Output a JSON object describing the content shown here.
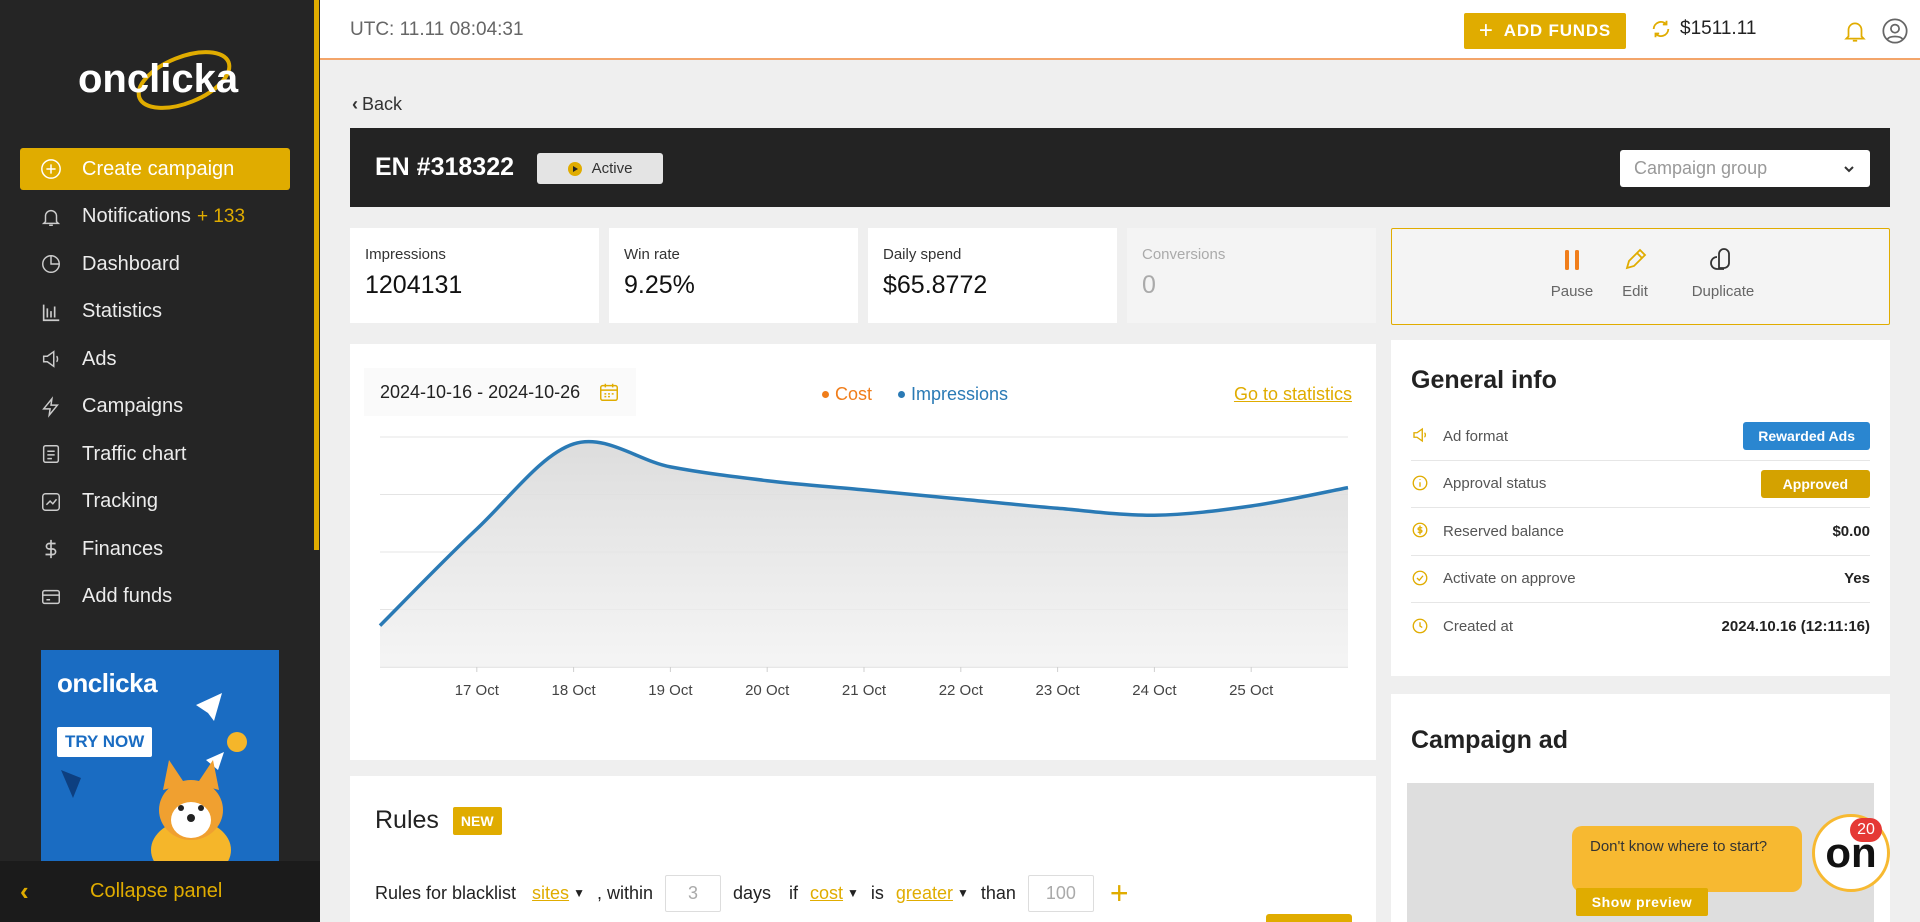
{
  "sidebar": {
    "logo_text": "onclicka",
    "items": [
      {
        "label": "Create campaign",
        "icon": "plus-circle-icon"
      },
      {
        "label": "Notifications",
        "badge": "+ 133",
        "icon": "bell-icon"
      },
      {
        "label": "Dashboard",
        "icon": "pie-chart-icon"
      },
      {
        "label": "Statistics",
        "icon": "bar-chart-icon"
      },
      {
        "label": "Ads",
        "icon": "megaphone-icon"
      },
      {
        "label": "Campaigns",
        "icon": "lightning-icon"
      },
      {
        "label": "Traffic chart",
        "icon": "document-icon"
      },
      {
        "label": "Tracking",
        "icon": "trend-icon"
      },
      {
        "label": "Finances",
        "icon": "dollar-icon"
      },
      {
        "label": "Add funds",
        "icon": "card-icon"
      }
    ],
    "promo": {
      "logo": "onclicka",
      "button": "TRY NOW"
    },
    "collapse_label": "Collapse panel"
  },
  "topbar": {
    "utc": "UTC: 11.11 08:04:31",
    "add_funds": "ADD FUNDS",
    "balance": "$1511.11"
  },
  "back_label": "Back",
  "campaign": {
    "title": "EN #318322",
    "status": "Active",
    "group_placeholder": "Campaign group"
  },
  "stats": [
    {
      "label": "Impressions",
      "value": "1204131"
    },
    {
      "label": "Win rate",
      "value": "9.25%"
    },
    {
      "label": "Daily spend",
      "value": "$65.8772"
    },
    {
      "label": "Conversions",
      "value": "0"
    }
  ],
  "actions": {
    "pause": "Pause",
    "edit": "Edit",
    "duplicate": "Duplicate"
  },
  "chart": {
    "date_range": "2024-10-16 - 2024-10-26",
    "legend_cost": "Cost",
    "legend_impressions": "Impressions",
    "goto": "Go to statistics"
  },
  "chart_data": {
    "type": "area",
    "categories": [
      "17 Oct",
      "18 Oct",
      "19 Oct",
      "20 Oct",
      "21 Oct",
      "22 Oct",
      "23 Oct",
      "24 Oct",
      "25 Oct"
    ],
    "series": [
      {
        "name": "Impressions",
        "color": "#2a7ab5",
        "x": [
          "16 Oct",
          "17 Oct",
          "18 Oct",
          "19 Oct",
          "20 Oct",
          "21 Oct",
          "22 Oct",
          "23 Oct",
          "24 Oct",
          "25 Oct",
          "26 Oct"
        ],
        "values": [
          0.18,
          0.6,
          0.97,
          0.87,
          0.81,
          0.77,
          0.73,
          0.69,
          0.66,
          0.7,
          0.78
        ]
      },
      {
        "name": "Cost",
        "color": "#f07d1a",
        "values": []
      }
    ],
    "grid": true,
    "legend": "top-center"
  },
  "general_info": {
    "title": "General info",
    "rows": [
      {
        "label": "Ad format",
        "value": "Rewarded Ads",
        "type": "badge",
        "color": "#2a86d0"
      },
      {
        "label": "Approval status",
        "value": "Approved",
        "type": "badge",
        "color": "#d4a200"
      },
      {
        "label": "Reserved balance",
        "value": "$0.00",
        "type": "text"
      },
      {
        "label": "Activate on approve",
        "value": "Yes",
        "type": "text"
      },
      {
        "label": "Created at",
        "value": "2024.10.16 (12:11:16)",
        "type": "text"
      }
    ]
  },
  "campaign_ad": {
    "title": "Campaign ad"
  },
  "rules": {
    "title": "Rules",
    "badge": "NEW",
    "prefix": "Rules for blacklist",
    "target": "sites",
    "within": ", within",
    "days_value": "3",
    "days": "days",
    "if": "if",
    "metric": "cost",
    "is": "is",
    "comparator": "greater",
    "than": "than",
    "threshold_placeholder": "100"
  },
  "help": {
    "bubble": "Don't know where to start?",
    "preview": "Show preview",
    "count": "20",
    "avatar": "on"
  }
}
